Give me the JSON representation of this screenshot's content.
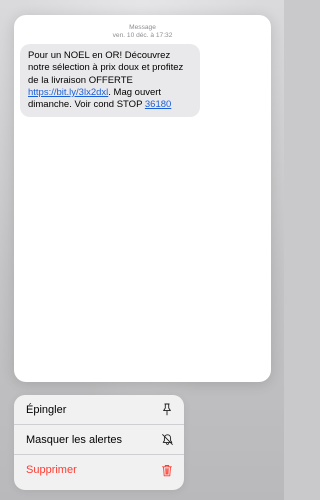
{
  "message": {
    "header_title": "Message",
    "header_time": "ven. 10 déc. à 17:32",
    "body_text_1": "Pour un NOEL en OR! Découvrez notre sélection à prix doux et profitez de la livraison OFFERTE ",
    "link_url": "https://bit.ly/3lx2dxl",
    "body_text_2": ". Mag ouvert dimanche. Voir cond STOP ",
    "stop_number": "36180"
  },
  "context_menu": {
    "items": [
      {
        "label": "Épingler",
        "icon": "pin-icon"
      },
      {
        "label": "Masquer les alertes",
        "icon": "bell-slash-icon"
      },
      {
        "label": "Supprimer",
        "icon": "trash-icon",
        "destructive": true
      }
    ]
  },
  "colors": {
    "link": "#1a5fd8",
    "destructive": "#ff3b30",
    "bubble": "#e9e9eb"
  }
}
